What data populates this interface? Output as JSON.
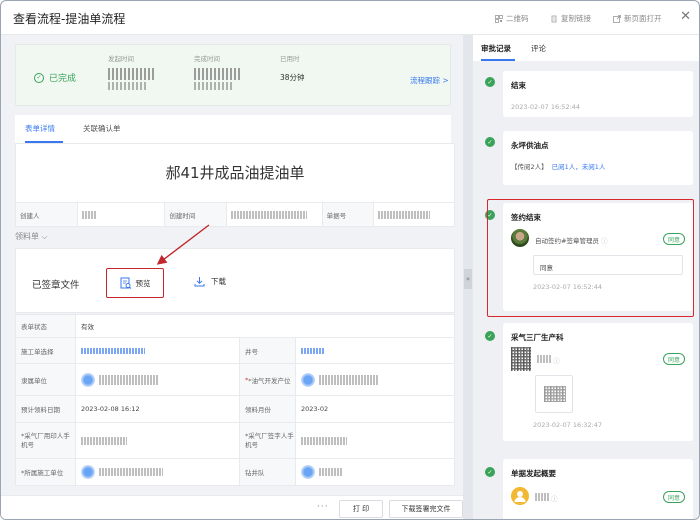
{
  "header": {
    "title": "查看流程-提油单流程",
    "actions": [
      {
        "label": "二维码",
        "icon": "qrcode-icon"
      },
      {
        "label": "复制链接",
        "icon": "copy-link-icon"
      },
      {
        "label": "新页面打开",
        "icon": "open-new-page-icon"
      }
    ]
  },
  "status_bar": {
    "state": "已完成",
    "columns": [
      {
        "label": "发起时间"
      },
      {
        "label": "完成时间"
      },
      {
        "label": "已用时",
        "value": "38分钟"
      }
    ],
    "trace_link": "流程跟踪 >"
  },
  "tabs": [
    {
      "label": "表单详情",
      "active": true
    },
    {
      "label": "关联确认单",
      "active": false
    }
  ],
  "form": {
    "title": "郝41井成品油提油单",
    "row1": [
      {
        "label": "创建人"
      },
      {
        "label": "创建时间"
      },
      {
        "label": "单据号"
      }
    ],
    "section_toggle": "领料单 ⌵",
    "signed_files_label": "已签章文件",
    "preview_label": "预览",
    "download_label": "下载",
    "fields": [
      {
        "label": "表单状态",
        "value": "有效"
      },
      {
        "label": "施工单选择",
        "label2": "井号"
      },
      {
        "label": "隶属单位",
        "label2": "*油气开发产位"
      },
      {
        "label": "预计领料日期",
        "value": "2023-02-08 16:12",
        "label2": "领料月份",
        "value2": "2023-02"
      },
      {
        "label": "*采气厂用印人手机号",
        "label2": "*采气厂签字人手机号"
      },
      {
        "label": "*所属施工单位",
        "label2": "钻井队"
      }
    ]
  },
  "footer": {
    "more": "···",
    "print_label": "打 印",
    "download_signed_label": "下载签署完文件"
  },
  "right_panel": {
    "tabs": [
      {
        "label": "审批记录",
        "active": true
      },
      {
        "label": "评论",
        "active": false
      }
    ],
    "records": [
      {
        "title": "结束",
        "time": "2023-02-07 16:52:44"
      },
      {
        "title": "永坪供油点",
        "line_prefix": "【传阅2人】",
        "line_links": "已阅1人，未阅1人"
      },
      {
        "title": "签约结束",
        "name": "自动签约#签章管理员",
        "badge": "同意",
        "comment": "同意",
        "time": "2023-02-07 16:52:44"
      },
      {
        "title": "采气三厂生产科",
        "badge": "同意",
        "time": "2023-02-07 16:32:47"
      },
      {
        "title": "单据发起概要",
        "badge": "同意"
      }
    ]
  },
  "colors": {
    "accent": "#3778f0",
    "success": "#3aa35a",
    "highlight": "#d7282f"
  }
}
